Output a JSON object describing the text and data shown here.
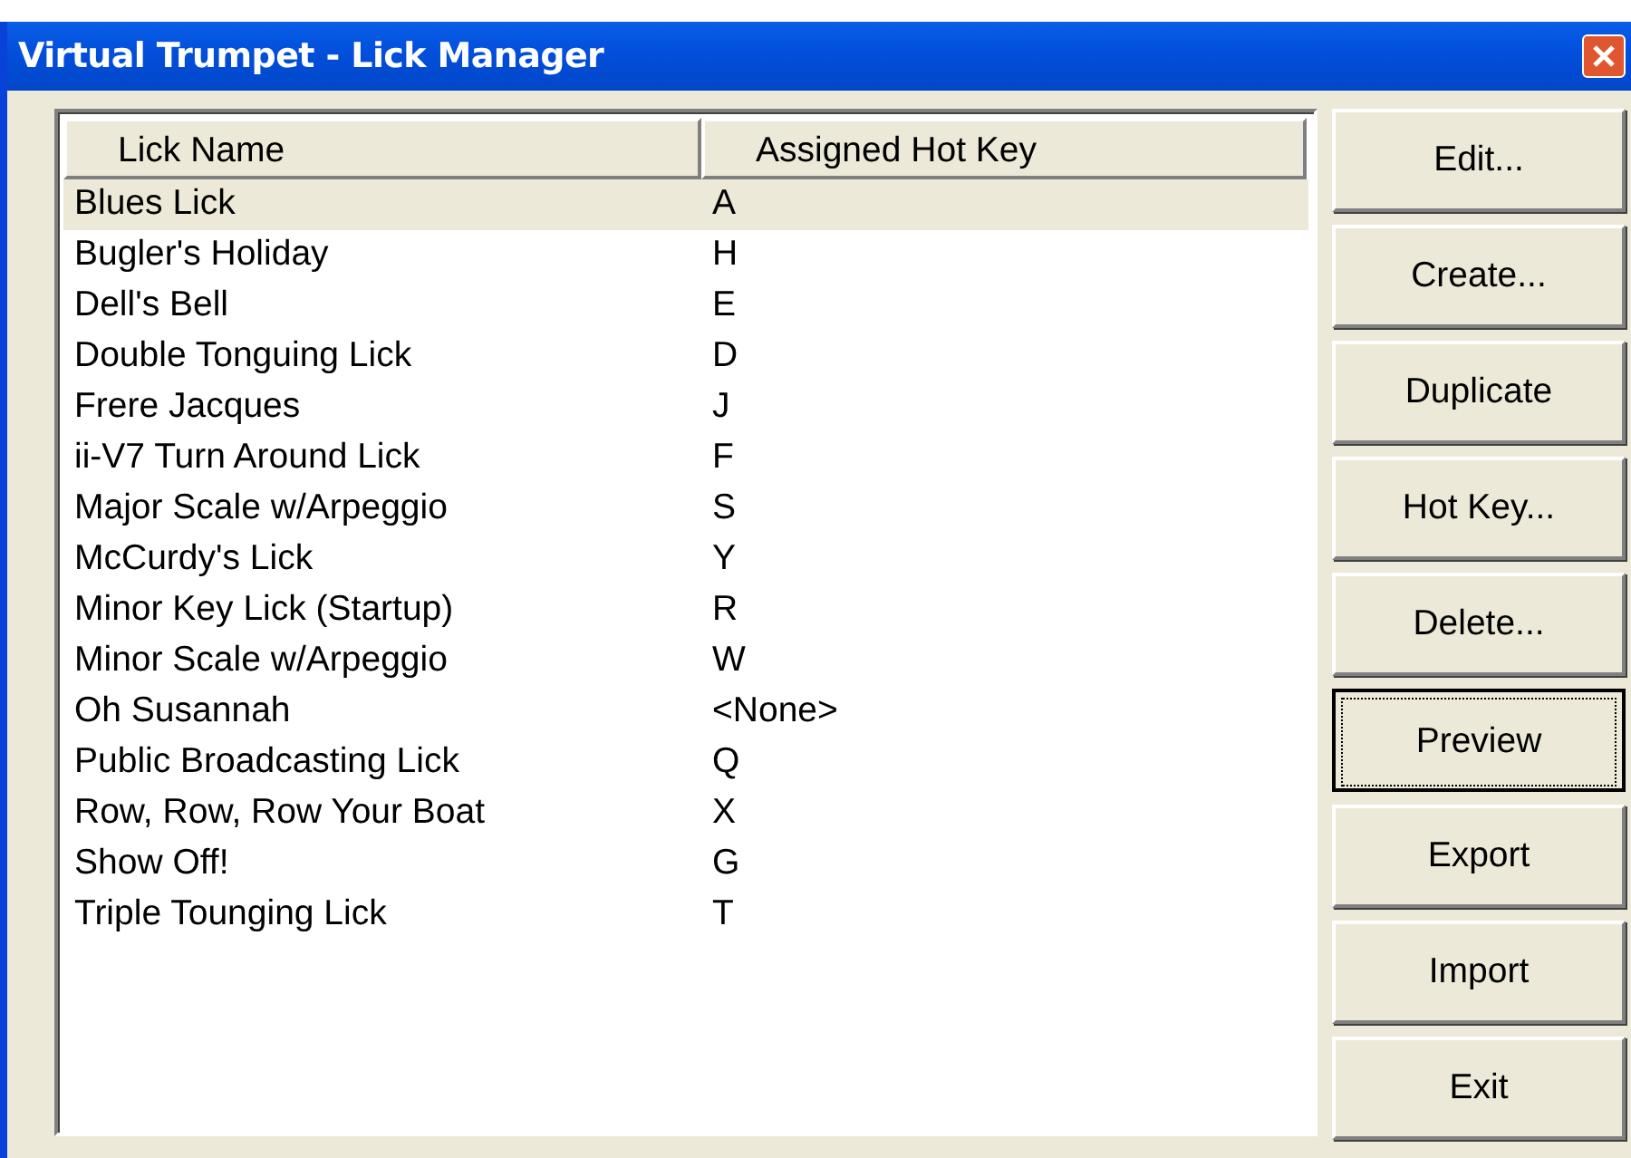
{
  "window": {
    "title": "Virtual Trumpet - Lick Manager"
  },
  "table": {
    "columns": [
      "Lick Name",
      "Assigned Hot Key"
    ],
    "rows": [
      {
        "name": "Blues Lick",
        "hot_key": "A",
        "selected": true
      },
      {
        "name": "Bugler's Holiday",
        "hot_key": "H",
        "selected": false
      },
      {
        "name": "Dell's Bell",
        "hot_key": "E",
        "selected": false
      },
      {
        "name": "Double Tonguing Lick",
        "hot_key": "D",
        "selected": false
      },
      {
        "name": "Frere Jacques",
        "hot_key": "J",
        "selected": false
      },
      {
        "name": "ii-V7 Turn Around Lick",
        "hot_key": "F",
        "selected": false
      },
      {
        "name": "Major Scale w/Arpeggio",
        "hot_key": "S",
        "selected": false
      },
      {
        "name": "McCurdy's Lick",
        "hot_key": "Y",
        "selected": false
      },
      {
        "name": "Minor Key Lick (Startup)",
        "hot_key": "R",
        "selected": false
      },
      {
        "name": "Minor Scale w/Arpeggio",
        "hot_key": "W",
        "selected": false
      },
      {
        "name": "Oh Susannah",
        "hot_key": "<None>",
        "selected": false
      },
      {
        "name": "Public Broadcasting Lick",
        "hot_key": "Q",
        "selected": false
      },
      {
        "name": "Row, Row, Row Your Boat",
        "hot_key": "X",
        "selected": false
      },
      {
        "name": "Show Off!",
        "hot_key": "G",
        "selected": false
      },
      {
        "name": "Triple Tounging Lick",
        "hot_key": "T",
        "selected": false
      }
    ]
  },
  "buttons": [
    {
      "label": "Edit...",
      "default": false
    },
    {
      "label": "Create...",
      "default": false
    },
    {
      "label": "Duplicate",
      "default": false
    },
    {
      "label": "Hot Key...",
      "default": false
    },
    {
      "label": "Delete...",
      "default": false
    },
    {
      "label": "Preview",
      "default": true
    },
    {
      "label": "Export",
      "default": false
    },
    {
      "label": "Import",
      "default": false
    },
    {
      "label": "Exit",
      "default": false
    }
  ]
}
